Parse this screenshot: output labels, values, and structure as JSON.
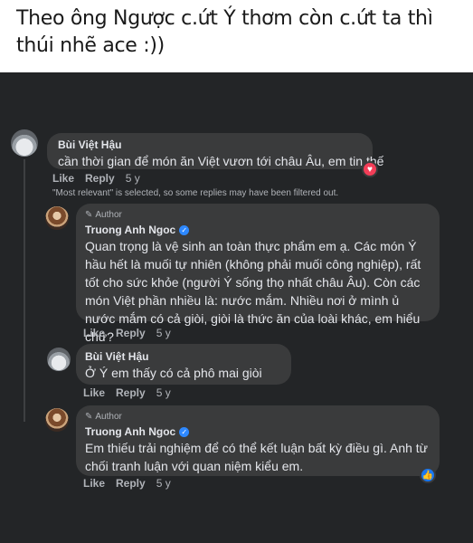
{
  "caption": "Theo ông Ngược c.ứt Ý thơm còn c.ứt ta thì thúi nhẽ ace :))",
  "actions": {
    "like": "Like",
    "reply": "Reply"
  },
  "filter_notice": "\"Most relevant\" is selected, so some replies may have been filtered out.",
  "comments": [
    {
      "name": "Bùi Việt Hậu",
      "text": "cần thời gian để món ăn Việt vươn tới châu Âu, em tin thế",
      "time": "5 y",
      "reaction": "heart"
    },
    {
      "author_label": "Author",
      "name": "Truong Anh Ngoc",
      "verified": true,
      "text": "Quan trọng là vệ sinh an toàn thực phẩm em ạ. Các món Ý hầu hết là muối tự nhiên (không phải muối công nghiệp), rất tốt cho sức khỏe (người Ý sống thọ nhất châu Âu). Còn các món Việt phần nhiều là: nước mắm. Nhiều nơi ở mình ủ nước mắm có cả giòi, giòi là thức ăn của loài khác, em hiểu chứ?",
      "time": "5 y"
    },
    {
      "name": "Bùi Việt Hậu",
      "text": "Ở Ý em thấy có cả phô mai giòi",
      "time": "5 y"
    },
    {
      "author_label": "Author",
      "name": "Truong Anh Ngoc",
      "verified": true,
      "text": "Em thiếu trải nghiệm để có thể kết luận bất kỳ điều gì. Anh từ chối tranh luận với quan niệm kiểu em.",
      "time": "5 y",
      "reaction": "like"
    }
  ],
  "icons": {
    "pencil": "pencil-icon",
    "verified": "verified-badge-icon",
    "heart": "heart-reaction-icon",
    "like": "like-reaction-icon"
  },
  "colors": {
    "background": "#232527",
    "bubble": "#3a3b3c",
    "text": "#e4e6eb",
    "muted": "#b0b3b8",
    "verified": "#2d88ff",
    "heart": "#f33e58",
    "like": "#1877f2"
  }
}
